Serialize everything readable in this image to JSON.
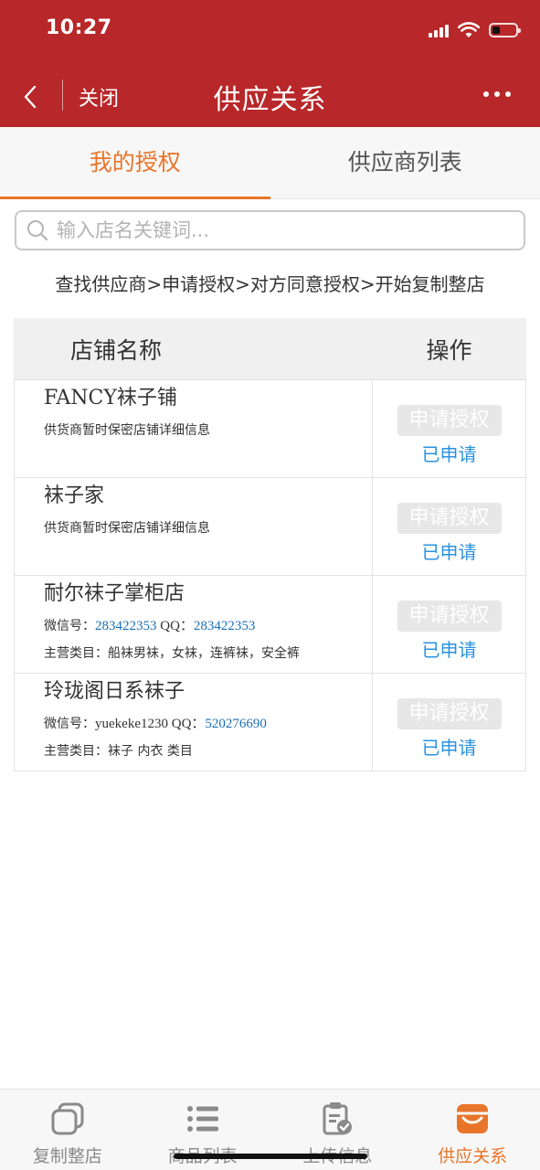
{
  "status_bar": {
    "time": "10:27"
  },
  "nav": {
    "close_label": "关闭",
    "title": "供应关系"
  },
  "tabs": [
    {
      "label": "我的授权",
      "active": true
    },
    {
      "label": "供应商列表",
      "active": false
    }
  ],
  "search": {
    "placeholder": "输入店名关键词...",
    "value": ""
  },
  "steps_text": "查找供应商>申请授权>对方同意授权>开始复制整店",
  "table": {
    "col_name": "店铺名称",
    "col_op": "操作",
    "apply_label": "申请授权",
    "applied_label": "已申请",
    "rows": [
      {
        "name": "FANCY袜子铺",
        "line1": "供货商暂时保密店铺详细信息"
      },
      {
        "name": "袜子家",
        "line1": "供货商暂时保密店铺详细信息"
      },
      {
        "name": "耐尔袜子掌柜店",
        "wechat_label": "微信号：",
        "wechat": "283422353",
        "qq_label": " QQ：",
        "qq": "283422353",
        "category_label": "主营类目：",
        "category": "船袜男袜，女袜，连裤袜，安全裤"
      },
      {
        "name": "玲珑阁日系袜子",
        "wechat_label": "微信号：",
        "wechat": "yuekeke1230",
        "qq_label": " QQ：",
        "qq": "520276690",
        "category_label": "主营类目：",
        "category": "袜子 内衣 类目"
      }
    ]
  },
  "bottom_nav": [
    {
      "label": "复制整店",
      "icon": "copy-icon",
      "active": false
    },
    {
      "label": "商品列表",
      "icon": "list-icon",
      "active": false
    },
    {
      "label": "上传信息",
      "icon": "clipboard-check-icon",
      "active": false
    },
    {
      "label": "供应关系",
      "icon": "store-icon",
      "active": true
    }
  ],
  "colors": {
    "header": "#b82729",
    "accent": "#e9752b",
    "link": "#1a6fb5",
    "applied": "#2a92e0"
  }
}
